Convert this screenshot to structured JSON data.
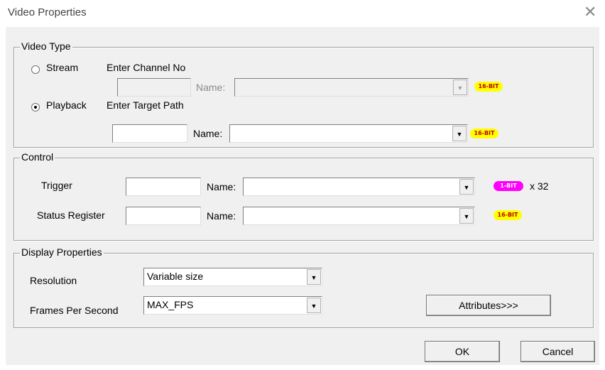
{
  "window": {
    "title": "Video Properties",
    "close_glyph": "✕"
  },
  "video_type": {
    "legend": "Video Type",
    "stream_label": "Stream",
    "stream_prompt": "Enter Channel No",
    "channel_value": "",
    "channel_name_label": "Name:",
    "channel_name_value": "",
    "channel_badge": "16-BIT",
    "playback_label": "Playback",
    "playback_prompt": "Enter Target Path",
    "target_value": "",
    "target_name_label": "Name:",
    "target_name_value": "",
    "target_badge": "16-BIT",
    "selected": "Playback"
  },
  "control": {
    "legend": "Control",
    "trigger_label": "Trigger",
    "trigger_value": "",
    "trigger_name_label": "Name:",
    "trigger_name_value": "",
    "trigger_badge": "1-BIT",
    "trigger_multiplier": "x 32",
    "status_label": "Status Register",
    "status_value": "",
    "status_name_label": "Name:",
    "status_name_value": "",
    "status_badge": "16-BIT"
  },
  "display": {
    "legend": "Display Properties",
    "resolution_label": "Resolution",
    "resolution_value": "Variable size",
    "fps_label": "Frames Per Second",
    "fps_value": "MAX_FPS",
    "attributes_button": "Attributes>>>"
  },
  "buttons": {
    "ok": "OK",
    "cancel": "Cancel"
  },
  "colors": {
    "badge_yellow": "#ffff00",
    "badge_magenta": "#ff00ff",
    "dialog_bg": "#f0f0f0"
  },
  "icons": {
    "dropdown": "▼"
  }
}
